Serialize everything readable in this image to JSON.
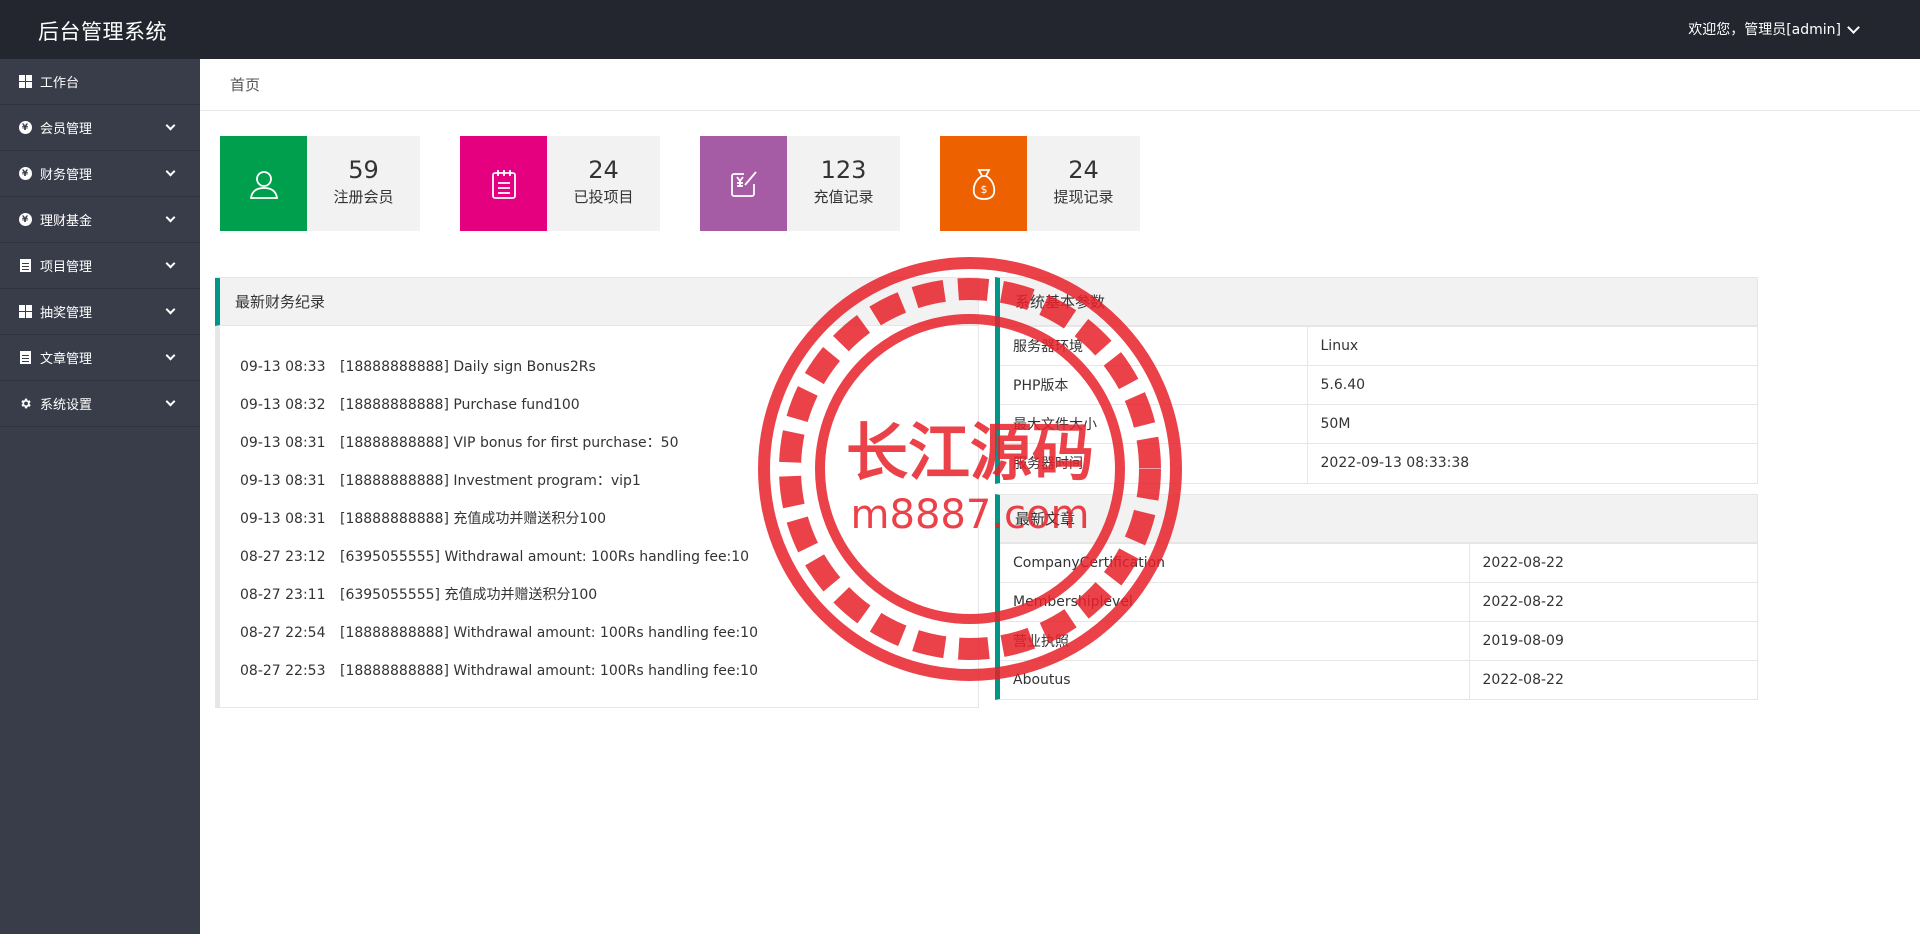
{
  "header": {
    "brand": "后台管理系统",
    "user": "欢迎您，管理员[admin]"
  },
  "sidebar": {
    "items": [
      {
        "label": "工作台"
      },
      {
        "label": "会员管理"
      },
      {
        "label": "财务管理"
      },
      {
        "label": "理财基金"
      },
      {
        "label": "项目管理"
      },
      {
        "label": "抽奖管理"
      },
      {
        "label": "文章管理"
      },
      {
        "label": "系统设置"
      }
    ]
  },
  "breadcrumb": "首页",
  "stats": [
    {
      "value": "59",
      "label": "注册会员",
      "color": "#009f4d"
    },
    {
      "value": "24",
      "label": "已投项目",
      "color": "#e4007f"
    },
    {
      "value": "123",
      "label": "充值记录",
      "color": "#a55ca5"
    },
    {
      "value": "24",
      "label": "提现记录",
      "color": "#ed6100"
    }
  ],
  "finance": {
    "title": "最新财务纪录",
    "rows": [
      {
        "time": "09-13 08:33",
        "text": "[18888888888] Daily sign Bonus2Rs"
      },
      {
        "time": "09-13 08:32",
        "text": "[18888888888] Purchase fund100"
      },
      {
        "time": "09-13 08:31",
        "text": "[18888888888] VIP bonus for first purchase：50"
      },
      {
        "time": "09-13 08:31",
        "text": "[18888888888] Investment program：vip1"
      },
      {
        "time": "09-13 08:31",
        "text": "[18888888888] 充值成功并赠送积分100"
      },
      {
        "time": "08-27 23:12",
        "text": "[6395055555] Withdrawal amount: 100Rs handling fee:10"
      },
      {
        "time": "08-27 23:11",
        "text": "[6395055555] 充值成功并赠送积分100"
      },
      {
        "time": "08-27 22:54",
        "text": "[18888888888] Withdrawal amount: 100Rs handling fee:10"
      },
      {
        "time": "08-27 22:53",
        "text": "[18888888888] Withdrawal amount: 100Rs handling fee:10"
      }
    ]
  },
  "system": {
    "title": "系统基本参数",
    "rows": [
      {
        "k": "服务器环境",
        "v": "Linux"
      },
      {
        "k": "PHP版本",
        "v": "5.6.40"
      },
      {
        "k": "最大文件大小",
        "v": "50M"
      },
      {
        "k": "服务器时间",
        "v": "2022-09-13 08:33:38"
      }
    ]
  },
  "articles": {
    "title": "最新文章",
    "rows": [
      {
        "k": "CompanyCertification",
        "v": "2022-08-22"
      },
      {
        "k": "Membershiplevel",
        "v": "2022-08-22"
      },
      {
        "k": "营业执照",
        "v": "2019-08-09"
      },
      {
        "k": "Aboutus",
        "v": "2022-08-22"
      }
    ]
  },
  "watermark": {
    "line1": "长江源码",
    "line2": "m8887.com",
    "color": "#e8202a"
  }
}
